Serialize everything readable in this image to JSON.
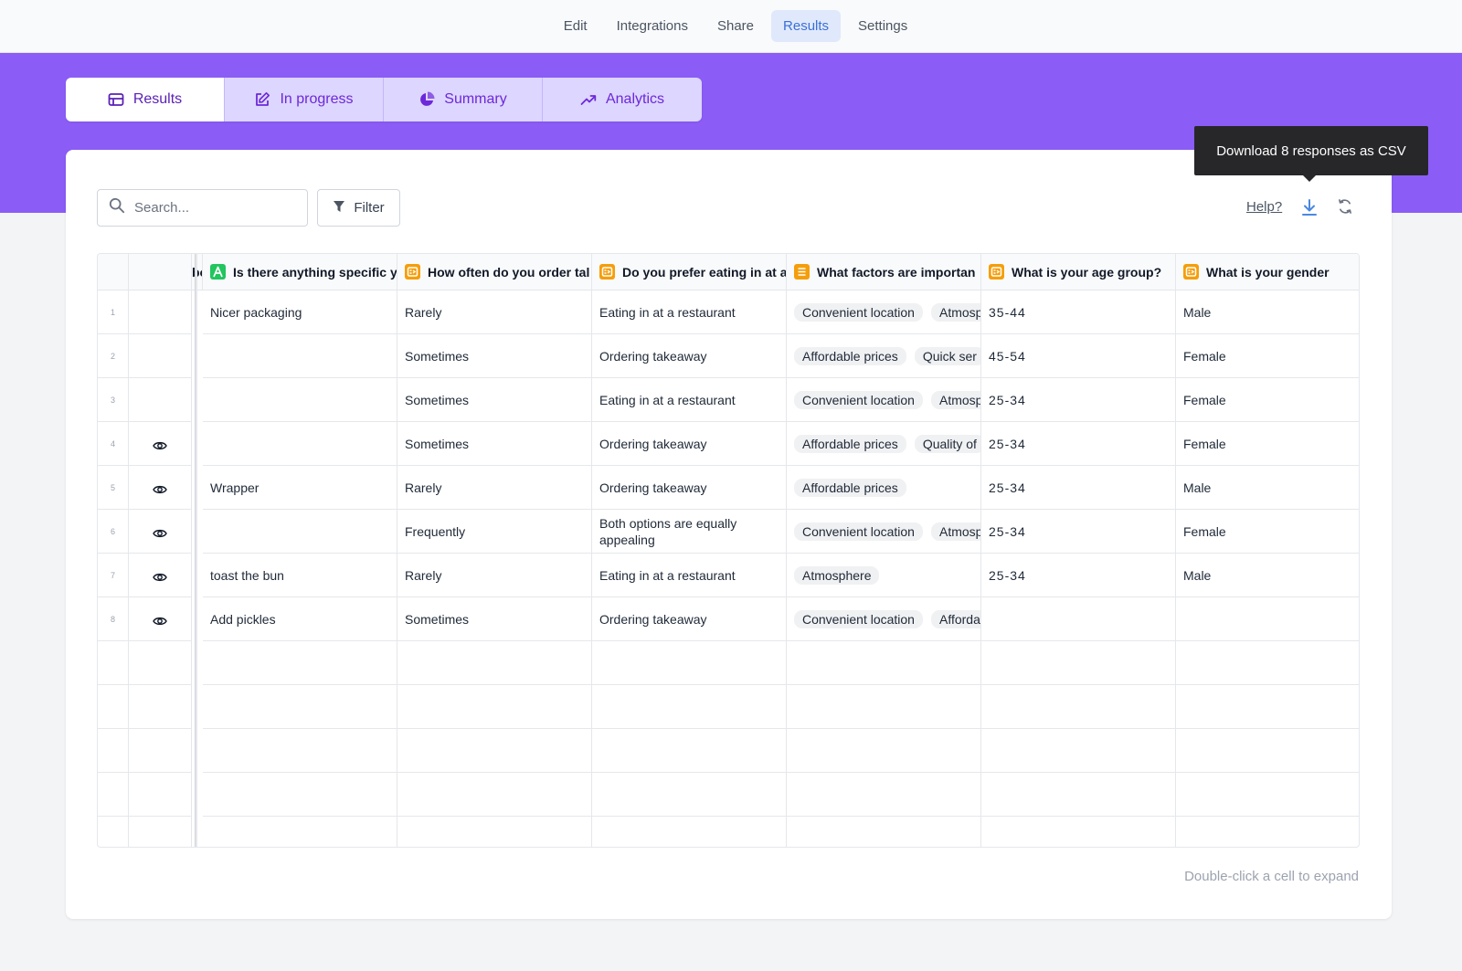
{
  "topnav": {
    "items": [
      {
        "label": "Edit",
        "active": false
      },
      {
        "label": "Integrations",
        "active": false
      },
      {
        "label": "Share",
        "active": false
      },
      {
        "label": "Results",
        "active": true
      },
      {
        "label": "Settings",
        "active": false
      }
    ]
  },
  "subtabs": [
    {
      "label": "Results",
      "icon": "table-icon",
      "active": true
    },
    {
      "label": "In progress",
      "icon": "edit-icon",
      "active": false
    },
    {
      "label": "Summary",
      "icon": "pie-chart-icon",
      "active": false
    },
    {
      "label": "Analytics",
      "icon": "trend-up-icon",
      "active": false
    }
  ],
  "toolbar": {
    "search_placeholder": "Search...",
    "filter_label": "Filter",
    "help_label": "Help?",
    "tooltip": "Download 8 responses as CSV"
  },
  "colors": {
    "brand_purple": "#8b5cf6",
    "active_nav": "#3b6fd8",
    "text_icon_green": "#22c55e",
    "choice_icon_yellow": "#f59e0b"
  },
  "table": {
    "partial_header": "bo",
    "columns": [
      {
        "label": "Is there anything specific y",
        "icon": "text-answer-icon"
      },
      {
        "label": "How often do you order tal",
        "icon": "single-choice-icon"
      },
      {
        "label": "Do you prefer eating in at a",
        "icon": "single-choice-icon"
      },
      {
        "label": "What factors are importan",
        "icon": "multi-choice-icon"
      },
      {
        "label": "What is your age group?",
        "icon": "single-choice-icon"
      },
      {
        "label": "What is your gender",
        "icon": "single-choice-icon"
      }
    ],
    "rows": [
      {
        "num": "1",
        "eye": false,
        "c1": "Nicer packaging",
        "c2": "Rarely",
        "c3": "Eating in at a restaurant",
        "tags": [
          "Convenient location",
          "Atmosp"
        ],
        "c5": "35-44",
        "c6": "Male"
      },
      {
        "num": "2",
        "eye": false,
        "c1": "",
        "c2": "Sometimes",
        "c3": "Ordering takeaway",
        "tags": [
          "Affordable prices",
          "Quick ser"
        ],
        "c5": "45-54",
        "c6": "Female"
      },
      {
        "num": "3",
        "eye": false,
        "c1": "",
        "c2": "Sometimes",
        "c3": "Eating in at a restaurant",
        "tags": [
          "Convenient location",
          "Atmosp"
        ],
        "c5": "25-34",
        "c6": "Female"
      },
      {
        "num": "4",
        "eye": true,
        "c1": "",
        "c2": "Sometimes",
        "c3": "Ordering takeaway",
        "tags": [
          "Affordable prices",
          "Quality of"
        ],
        "c5": "25-34",
        "c6": "Female"
      },
      {
        "num": "5",
        "eye": true,
        "c1": "Wrapper",
        "c2": "Rarely",
        "c3": "Ordering takeaway",
        "tags": [
          "Affordable prices"
        ],
        "c5": "25-34",
        "c6": "Male"
      },
      {
        "num": "6",
        "eye": true,
        "c1": "",
        "c2": "Frequently",
        "c3": "Both options are equally appealing",
        "tags": [
          "Convenient location",
          "Atmosp"
        ],
        "c5": "25-34",
        "c6": "Female"
      },
      {
        "num": "7",
        "eye": true,
        "c1": "toast the bun",
        "c2": "Rarely",
        "c3": "Eating in at a restaurant",
        "tags": [
          "Atmosphere"
        ],
        "c5": "25-34",
        "c6": "Male"
      },
      {
        "num": "8",
        "eye": true,
        "c1": "Add pickles",
        "c2": "Sometimes",
        "c3": "Ordering takeaway",
        "tags": [
          "Convenient location",
          "Afforda"
        ],
        "c5": "",
        "c6": ""
      }
    ],
    "empty_rows": 4
  },
  "footer_note": "Double-click a cell to expand"
}
